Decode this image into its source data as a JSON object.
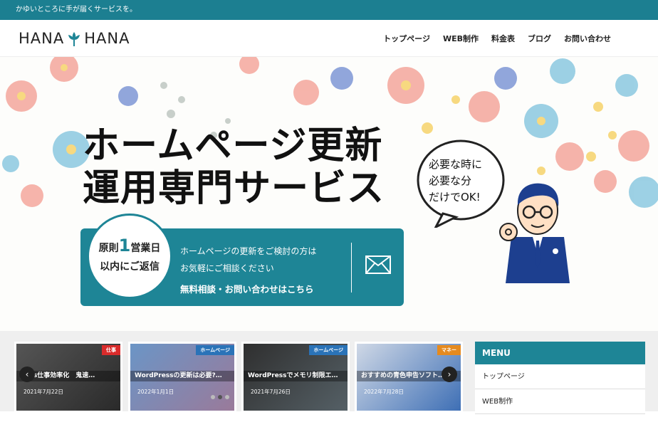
{
  "topbar": {
    "tagline": "かゆいところに手が届くサービスを。"
  },
  "logo": {
    "left": "HANA",
    "right": "HANA"
  },
  "nav": [
    "トップページ",
    "WEB制作",
    "料金表",
    "ブログ",
    "お問い合わせ"
  ],
  "hero": {
    "title_line1": "ホームページ更新",
    "title_line2": "運用専門サービス",
    "bubble": [
      "必要な時に",
      "必要な分",
      "だけでOK!"
    ],
    "badge": {
      "line1_pre": "原則",
      "line1_num": "1",
      "line1_post": "営業日",
      "line2": "以内にご返信"
    },
    "cta": {
      "line1": "ホームページの更新をご検討の方は",
      "line2": "お気軽にご相談ください",
      "link": "無料相談・お問い合わせはこちら"
    }
  },
  "cards": [
    {
      "tag": "仕事",
      "tag_color": "#d92b2b",
      "title": "Jows仕事効率化　鬼速…",
      "date": "2021年7月22日"
    },
    {
      "tag": "ホームページ",
      "tag_color": "#2a73b8",
      "title": "WordPressの更新は必要?…",
      "date": "2022年1月1日"
    },
    {
      "tag": "ホームページ",
      "tag_color": "#2a73b8",
      "title": "WordPressでメモリ制限エ…",
      "date": "2021年7月26日"
    },
    {
      "tag": "マネー",
      "tag_color": "#e58a1f",
      "title": "おすすめの青色申告ソフト…",
      "date": "2022年7月28日"
    }
  ],
  "carousel": {
    "prev": "‹",
    "next": "›"
  },
  "menu": {
    "heading": "MENU",
    "items": [
      "トップページ",
      "WEB制作"
    ]
  },
  "colors": {
    "brand": "#1c7f91",
    "cta": "#1e8596"
  }
}
